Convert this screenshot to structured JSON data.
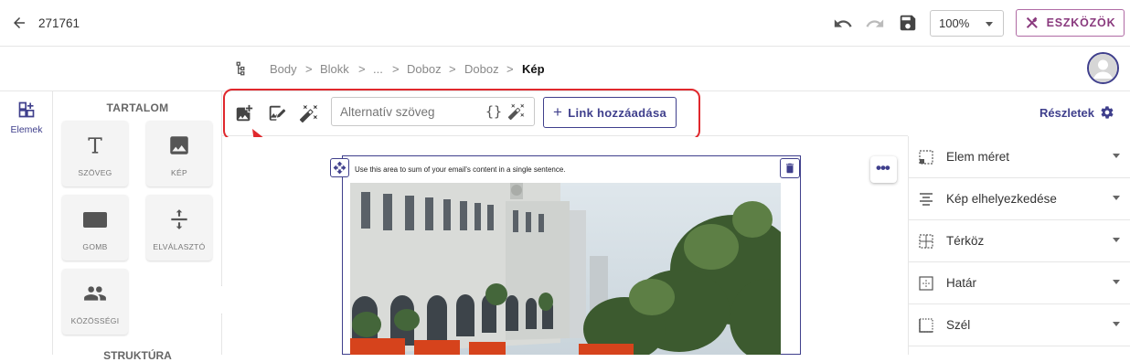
{
  "header": {
    "doc_id": "271761",
    "zoom_value": "100%",
    "tools_label": "ESZKÖZÖK"
  },
  "breadcrumb": {
    "items": [
      "Body",
      "Blokk",
      "...",
      "Doboz",
      "Doboz"
    ],
    "separator": ">",
    "current": "Kép"
  },
  "left_rail": {
    "elements_label": "Elemek"
  },
  "elements_panel": {
    "section_title": "TARTALOM",
    "tiles": [
      "SZÖVEG",
      "KÉP",
      "GOMB",
      "ELVÁLASZTÓ",
      "KÖZÖSSÉGI"
    ],
    "next_section_partial": "STRUKTÚRA"
  },
  "image_toolbar": {
    "alt_placeholder": "Alternatív szöveg",
    "link_button_label": "Link hozzáadása"
  },
  "details": {
    "label": "Részletek",
    "properties": [
      "Elem méret",
      "Kép elhelyezkedése",
      "Térköz",
      "Határ",
      "Szél"
    ]
  },
  "canvas": {
    "hint_text": "Use this area to sum of your email's content in a single sentence."
  },
  "colors": {
    "accent": "#3f3f8c",
    "tools": "#8a3a7e",
    "highlight": "#e0282d"
  }
}
